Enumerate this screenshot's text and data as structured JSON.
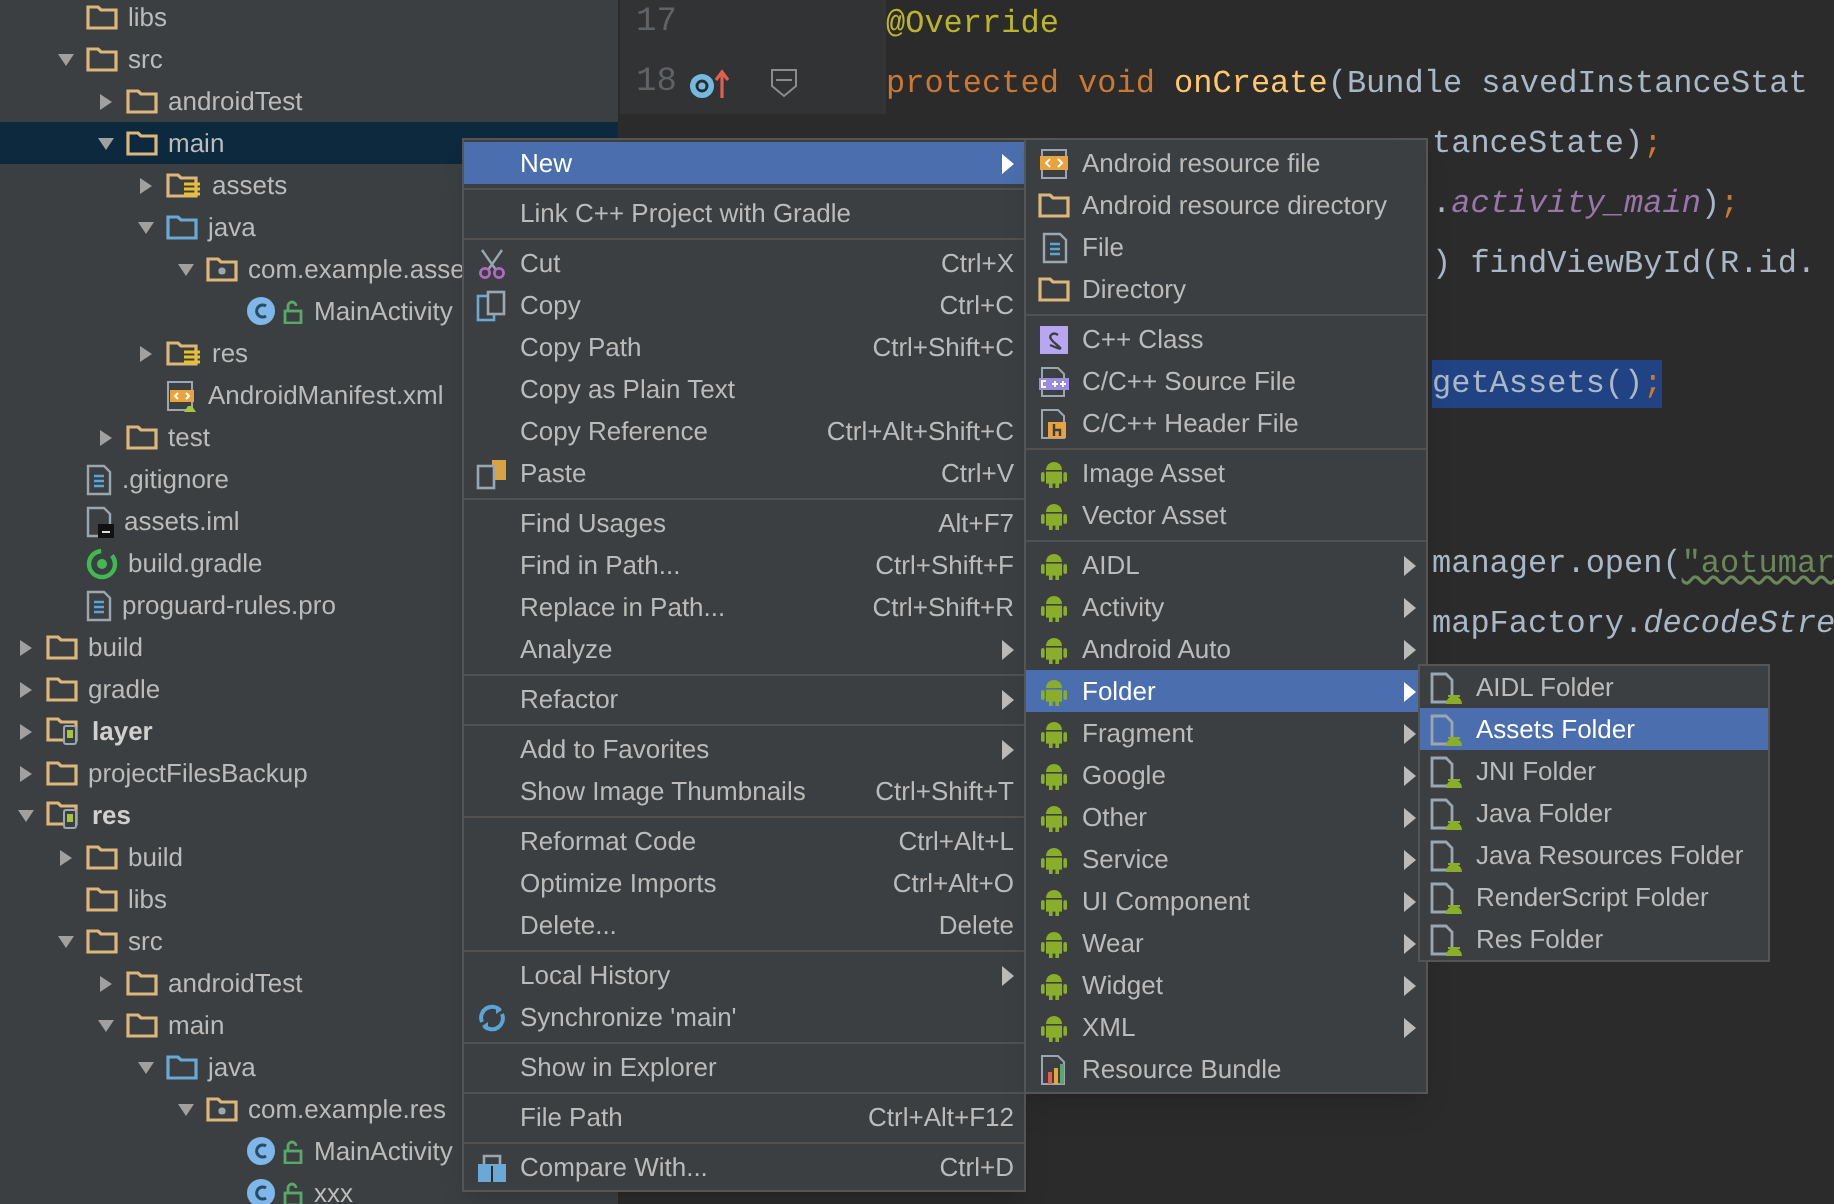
{
  "module_contents": [
    {
      "label": "libs",
      "kind": "folder",
      "selected": false
    },
    {
      "label": "src",
      "kind": "folder",
      "selected": false,
      "expanded": true,
      "children": [
        {
          "label": "androidTest",
          "kind": "folder",
          "selected": false,
          "expanded": false
        },
        {
          "label": "main",
          "kind": "folder",
          "selected": true,
          "expanded": true,
          "children": [
            {
              "label": "assets",
              "kind": "resource-folder",
              "selected": false,
              "expanded": false
            },
            {
              "label": "java",
              "kind": "source-folder",
              "selected": false,
              "expanded": true,
              "children": [
                {
                  "label": "com.example.asse",
                  "kind": "package",
                  "selected": false,
                  "expanded": true,
                  "children": [
                    {
                      "label": "MainActivity",
                      "kind": "class",
                      "selected": false
                    }
                  ]
                }
              ]
            },
            {
              "label": "res",
              "kind": "resource-folder",
              "selected": false,
              "expanded": false
            },
            {
              "label": "AndroidManifest.xml",
              "kind": "manifest",
              "selected": false
            }
          ]
        },
        {
          "label": "test",
          "kind": "folder",
          "selected": false,
          "expanded": false
        }
      ]
    },
    {
      "label": ".gitignore",
      "kind": "text-file",
      "selected": false
    },
    {
      "label": "assets.iml",
      "kind": "iml",
      "selected": false
    },
    {
      "label": "build.gradle",
      "kind": "gradle",
      "selected": false
    },
    {
      "label": "proguard-rules.pro",
      "kind": "text-file",
      "selected": false
    }
  ],
  "project_tree": [
    {
      "label": "build",
      "kind": "folder",
      "selected": false,
      "expanded": false
    },
    {
      "label": "gradle",
      "kind": "folder",
      "selected": false,
      "expanded": false
    },
    {
      "label": "layer",
      "kind": "module",
      "selected": false,
      "expanded": false
    },
    {
      "label": "projectFilesBackup",
      "kind": "folder",
      "selected": false,
      "expanded": false
    },
    {
      "label": "res",
      "kind": "module",
      "selected": false,
      "expanded": true,
      "children": [
        {
          "label": "build",
          "kind": "folder",
          "selected": false,
          "expanded": false
        },
        {
          "label": "libs",
          "kind": "folder",
          "selected": false
        },
        {
          "label": "src",
          "kind": "folder",
          "selected": false,
          "expanded": true,
          "children": [
            {
              "label": "androidTest",
              "kind": "folder",
              "selected": false,
              "expanded": false
            },
            {
              "label": "main",
              "kind": "folder",
              "selected": false,
              "expanded": true,
              "children": [
                {
                  "label": "java",
                  "kind": "source-folder",
                  "selected": false,
                  "expanded": true,
                  "children": [
                    {
                      "label": "com.example.res",
                      "kind": "package",
                      "selected": false,
                      "expanded": true,
                      "children": [
                        {
                          "label": "MainActivity",
                          "kind": "class",
                          "selected": false
                        },
                        {
                          "label": "xxx",
                          "kind": "class",
                          "selected": false
                        }
                      ]
                    }
                  ]
                }
              ]
            }
          ]
        }
      ]
    }
  ],
  "editor": {
    "lines": [
      {
        "kind": "full",
        "number": "17",
        "tokens": [
          {
            "text": "@Override",
            "kind": "annotation"
          }
        ]
      },
      {
        "kind": "method",
        "number": "18",
        "tokens": [
          {
            "text": "protected void ",
            "kind": "keyword"
          },
          {
            "text": "onCreate",
            "kind": "method"
          },
          {
            "text": "(Bundle savedInstanceStat",
            "kind": "plain"
          }
        ]
      },
      {
        "kind": "right",
        "tokens": [
          {
            "text": "tanceState)",
            "kind": "plain"
          },
          {
            "text": ";",
            "kind": "keyword"
          }
        ]
      },
      {
        "kind": "right",
        "tokens": [
          {
            "text": ".",
            "kind": "plain"
          },
          {
            "text": "activity_main",
            "kind": "field"
          },
          {
            "text": ")",
            "kind": "plain"
          },
          {
            "text": ";",
            "kind": "keyword"
          }
        ]
      },
      {
        "kind": "right",
        "tokens": [
          {
            "text": ") findViewById(R.id.",
            "kind": "plain"
          }
        ]
      },
      {
        "kind": "blank"
      },
      {
        "kind": "right",
        "tokens": [
          {
            "text": "getAssets()",
            "kind": "plain",
            "highlighted": true
          },
          {
            "text": ";",
            "kind": "keyword",
            "highlighted": true
          }
        ]
      },
      {
        "kind": "blank"
      },
      {
        "kind": "blank"
      },
      {
        "kind": "right",
        "tokens": [
          {
            "text": "manager.open(",
            "kind": "plain"
          },
          {
            "text": "\"aotumar",
            "kind": "string"
          }
        ]
      },
      {
        "kind": "right",
        "tokens": [
          {
            "text": "mapFactory.",
            "kind": "plain"
          },
          {
            "text": "decodeStre",
            "kind": "static"
          }
        ]
      }
    ]
  },
  "context_menu": [
    {
      "kind": "item",
      "label": "New",
      "submenu": true,
      "selected": true
    },
    {
      "kind": "separator"
    },
    {
      "kind": "item",
      "label": "Link C++ Project with Gradle",
      "selected": false
    },
    {
      "kind": "separator"
    },
    {
      "kind": "cut",
      "label": "Cut",
      "shortcut": "Ctrl+X",
      "selected": false
    },
    {
      "kind": "copy",
      "label": "Copy",
      "shortcut": "Ctrl+C",
      "selected": false
    },
    {
      "kind": "item",
      "label": "Copy Path",
      "shortcut": "Ctrl+Shift+C",
      "selected": false
    },
    {
      "kind": "item",
      "label": "Copy as Plain Text",
      "selected": false
    },
    {
      "kind": "item",
      "label": "Copy Reference",
      "shortcut": "Ctrl+Alt+Shift+C",
      "selected": false
    },
    {
      "kind": "paste",
      "label": "Paste",
      "shortcut": "Ctrl+V",
      "selected": false
    },
    {
      "kind": "separator"
    },
    {
      "kind": "item",
      "label": "Find Usages",
      "shortcut": "Alt+F7",
      "selected": false
    },
    {
      "kind": "item",
      "label": "Find in Path...",
      "shortcut": "Ctrl+Shift+F",
      "selected": false
    },
    {
      "kind": "item",
      "label": "Replace in Path...",
      "shortcut": "Ctrl+Shift+R",
      "selected": false
    },
    {
      "kind": "item",
      "label": "Analyze",
      "submenu": true,
      "selected": false
    },
    {
      "kind": "separator"
    },
    {
      "kind": "item",
      "label": "Refactor",
      "submenu": true,
      "selected": false
    },
    {
      "kind": "separator"
    },
    {
      "kind": "item",
      "label": "Add to Favorites",
      "submenu": true,
      "selected": false
    },
    {
      "kind": "item",
      "label": "Show Image Thumbnails",
      "shortcut": "Ctrl+Shift+T",
      "selected": false
    },
    {
      "kind": "separator"
    },
    {
      "kind": "item",
      "label": "Reformat Code",
      "shortcut": "Ctrl+Alt+L",
      "selected": false
    },
    {
      "kind": "item",
      "label": "Optimize Imports",
      "shortcut": "Ctrl+Alt+O",
      "selected": false
    },
    {
      "kind": "item",
      "label": "Delete...",
      "shortcut": "Delete",
      "selected": false
    },
    {
      "kind": "separator"
    },
    {
      "kind": "item",
      "label": "Local History",
      "submenu": true,
      "selected": false
    },
    {
      "kind": "sync",
      "label": "Synchronize 'main'",
      "selected": false
    },
    {
      "kind": "separator"
    },
    {
      "kind": "item",
      "label": "Show in Explorer",
      "selected": false
    },
    {
      "kind": "separator"
    },
    {
      "kind": "item",
      "label": "File Path",
      "shortcut": "Ctrl+Alt+F12",
      "selected": false
    },
    {
      "kind": "separator"
    },
    {
      "kind": "compare",
      "label": "Compare With...",
      "shortcut": "Ctrl+D",
      "selected": false
    }
  ],
  "new_submenu": [
    {
      "kind": "resource-file",
      "label": "Android resource file",
      "selected": false
    },
    {
      "kind": "folder",
      "label": "Android resource directory",
      "selected": false
    },
    {
      "kind": "file",
      "label": "File",
      "selected": false
    },
    {
      "kind": "folder",
      "label": "Directory",
      "selected": false
    },
    {
      "kind": "separator"
    },
    {
      "kind": "cpp-class",
      "label": "C++ Class",
      "selected": false
    },
    {
      "kind": "cpp-source",
      "label": "C/C++ Source File",
      "selected": false
    },
    {
      "kind": "cpp-header",
      "label": "C/C++ Header File",
      "selected": false
    },
    {
      "kind": "separator"
    },
    {
      "kind": "android",
      "label": "Image Asset",
      "selected": false
    },
    {
      "kind": "android",
      "label": "Vector Asset",
      "selected": false
    },
    {
      "kind": "separator"
    },
    {
      "kind": "android",
      "label": "AIDL",
      "submenu": true,
      "selected": false
    },
    {
      "kind": "android",
      "label": "Activity",
      "submenu": true,
      "selected": false
    },
    {
      "kind": "android",
      "label": "Android Auto",
      "submenu": true,
      "selected": false
    },
    {
      "kind": "android",
      "label": "Folder",
      "submenu": true,
      "selected": true
    },
    {
      "kind": "android",
      "label": "Fragment",
      "submenu": true,
      "selected": false
    },
    {
      "kind": "android",
      "label": "Google",
      "submenu": true,
      "selected": false
    },
    {
      "kind": "android",
      "label": "Other",
      "submenu": true,
      "selected": false
    },
    {
      "kind": "android",
      "label": "Service",
      "submenu": true,
      "selected": false
    },
    {
      "kind": "android",
      "label": "UI Component",
      "submenu": true,
      "selected": false
    },
    {
      "kind": "android",
      "label": "Wear",
      "submenu": true,
      "selected": false
    },
    {
      "kind": "android",
      "label": "Widget",
      "submenu": true,
      "selected": false
    },
    {
      "kind": "android",
      "label": "XML",
      "submenu": true,
      "selected": false
    },
    {
      "kind": "bundle",
      "label": "Resource Bundle",
      "selected": false
    }
  ],
  "folder_submenu": [
    {
      "label": "AIDL Folder",
      "selected": false
    },
    {
      "label": "Assets Folder",
      "selected": true
    },
    {
      "label": "JNI Folder",
      "selected": false
    },
    {
      "label": "Java Folder",
      "selected": false
    },
    {
      "label": "Java Resources Folder",
      "selected": false
    },
    {
      "label": "RenderScript Folder",
      "selected": false
    },
    {
      "label": "Res Folder",
      "selected": false
    }
  ]
}
